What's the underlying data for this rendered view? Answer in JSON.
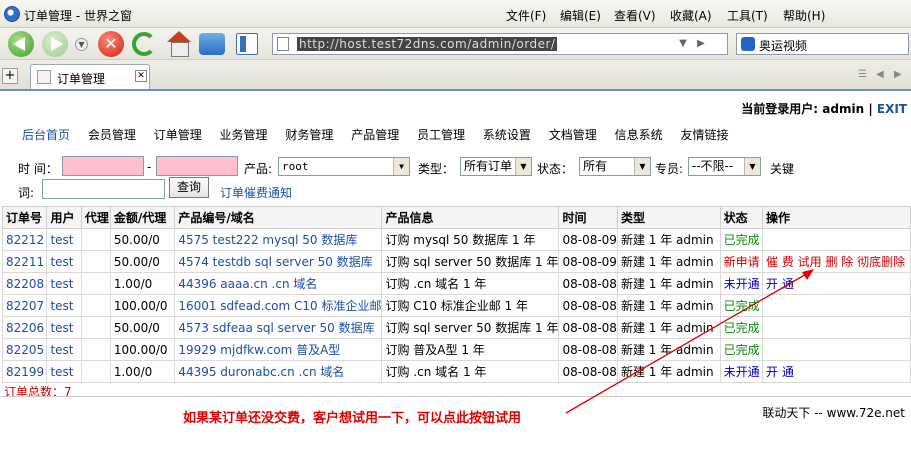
{
  "window": {
    "title": "订单管理 - 世界之窗",
    "menus": [
      "文件(F)",
      "编辑(E)",
      "查看(V)",
      "收藏(A)",
      "工具(T)",
      "帮助(H)"
    ]
  },
  "toolbar": {
    "address": "http://host.test72dns.com/admin/order/",
    "search_text": "奥运视频"
  },
  "tab": {
    "label": "订单管理",
    "close": "✕",
    "new": "+"
  },
  "user": {
    "label": "当前登录用户:",
    "name": "admin",
    "separator": "|",
    "exit": "EXIT"
  },
  "nav": {
    "home": "后台首页",
    "items": [
      "会员管理",
      "订单管理",
      "业务管理",
      "财务管理",
      "产品管理",
      "员工管理",
      "系统设置",
      "文档管理",
      "信息系统",
      "友情链接"
    ]
  },
  "filter": {
    "time_label": "时 间：",
    "dash": "-",
    "product_label": "产品:",
    "product_value": "root",
    "type_label": "类型：",
    "type_value": "所有订单",
    "status_label": "状态：",
    "status_value": "所有",
    "staff_label": "专员:",
    "staff_value": "--不限--",
    "keyword_label_1": "关键",
    "keyword_label_2": "词:",
    "query_button": "查询",
    "notify_link": "订单催费通知"
  },
  "table": {
    "headers": [
      "订单号",
      "用户",
      "代理",
      "金额/代理",
      "产品编号/域名",
      "产品信息",
      "时间",
      "类型",
      "状态",
      "操作"
    ],
    "rows": [
      {
        "id": "82212",
        "user": "test",
        "agent": "",
        "amount": "50.00/0",
        "product": "4575 test222  mysql 50 数据库",
        "info": "订购 mysql 50 数据库 1 年",
        "date": "08-08-09",
        "type": "新建 1 年   admin",
        "status": "已完成",
        "ops": ""
      },
      {
        "id": "82211",
        "user": "test",
        "agent": "",
        "amount": "50.00/0",
        "product": "4574 testdb  sql server 50 数据库",
        "info": "订购 sql server 50 数据库 1 年",
        "date": "08-08-09",
        "type": "新建 1 年   admin",
        "status": "新申请",
        "ops": "催 费 试用 删 除 彻底删除"
      },
      {
        "id": "82208",
        "user": "test",
        "agent": "",
        "amount": "1.00/0",
        "product": "44396 aaaa.cn  .cn 域名",
        "info": "订购 .cn 域名 1 年",
        "date": "08-08-08",
        "type": "新建 1 年   admin",
        "status": "未开通",
        "ops": "开 通"
      },
      {
        "id": "82207",
        "user": "test",
        "agent": "",
        "amount": "100.00/0",
        "product": "16001 sdfead.com  C10 标准企业邮",
        "info": "订购 C10 标准企业邮 1 年",
        "date": "08-08-08",
        "type": "新建 1 年   admin",
        "status": "已完成",
        "ops": ""
      },
      {
        "id": "82206",
        "user": "test",
        "agent": "",
        "amount": "50.00/0",
        "product": "4573 sdfeaa  sql server 50 数据库",
        "info": "订购 sql server 50 数据库 1 年",
        "date": "08-08-08",
        "type": "新建 1 年   admin",
        "status": "已完成",
        "ops": ""
      },
      {
        "id": "82205",
        "user": "test",
        "agent": "",
        "amount": "100.00/0",
        "product": "19929 mjdfkw.com   普及A型",
        "info": "订购 普及A型 1 年",
        "date": "08-08-08",
        "type": "新建 1 年   admin",
        "status": "已完成",
        "ops": ""
      },
      {
        "id": "82199",
        "user": "test",
        "agent": "",
        "amount": "1.00/0",
        "product": "44395 duronabc.cn  .cn 域名",
        "info": "订购 .cn 域名 1 年",
        "date": "08-08-08",
        "type": "新建 1 年   admin",
        "status": "未开通",
        "ops": "开 通"
      }
    ]
  },
  "totals": "订单总数：7",
  "footer": "联动天下 -- www.72e.net",
  "annotation": "如果某订单还没交费，客户想试用一下，可以点此按钮试用",
  "colors": {
    "accent": "#1d4fa5",
    "danger": "#d40000",
    "success": "#0a8a0a",
    "pink_field": "#ffc0cb"
  }
}
